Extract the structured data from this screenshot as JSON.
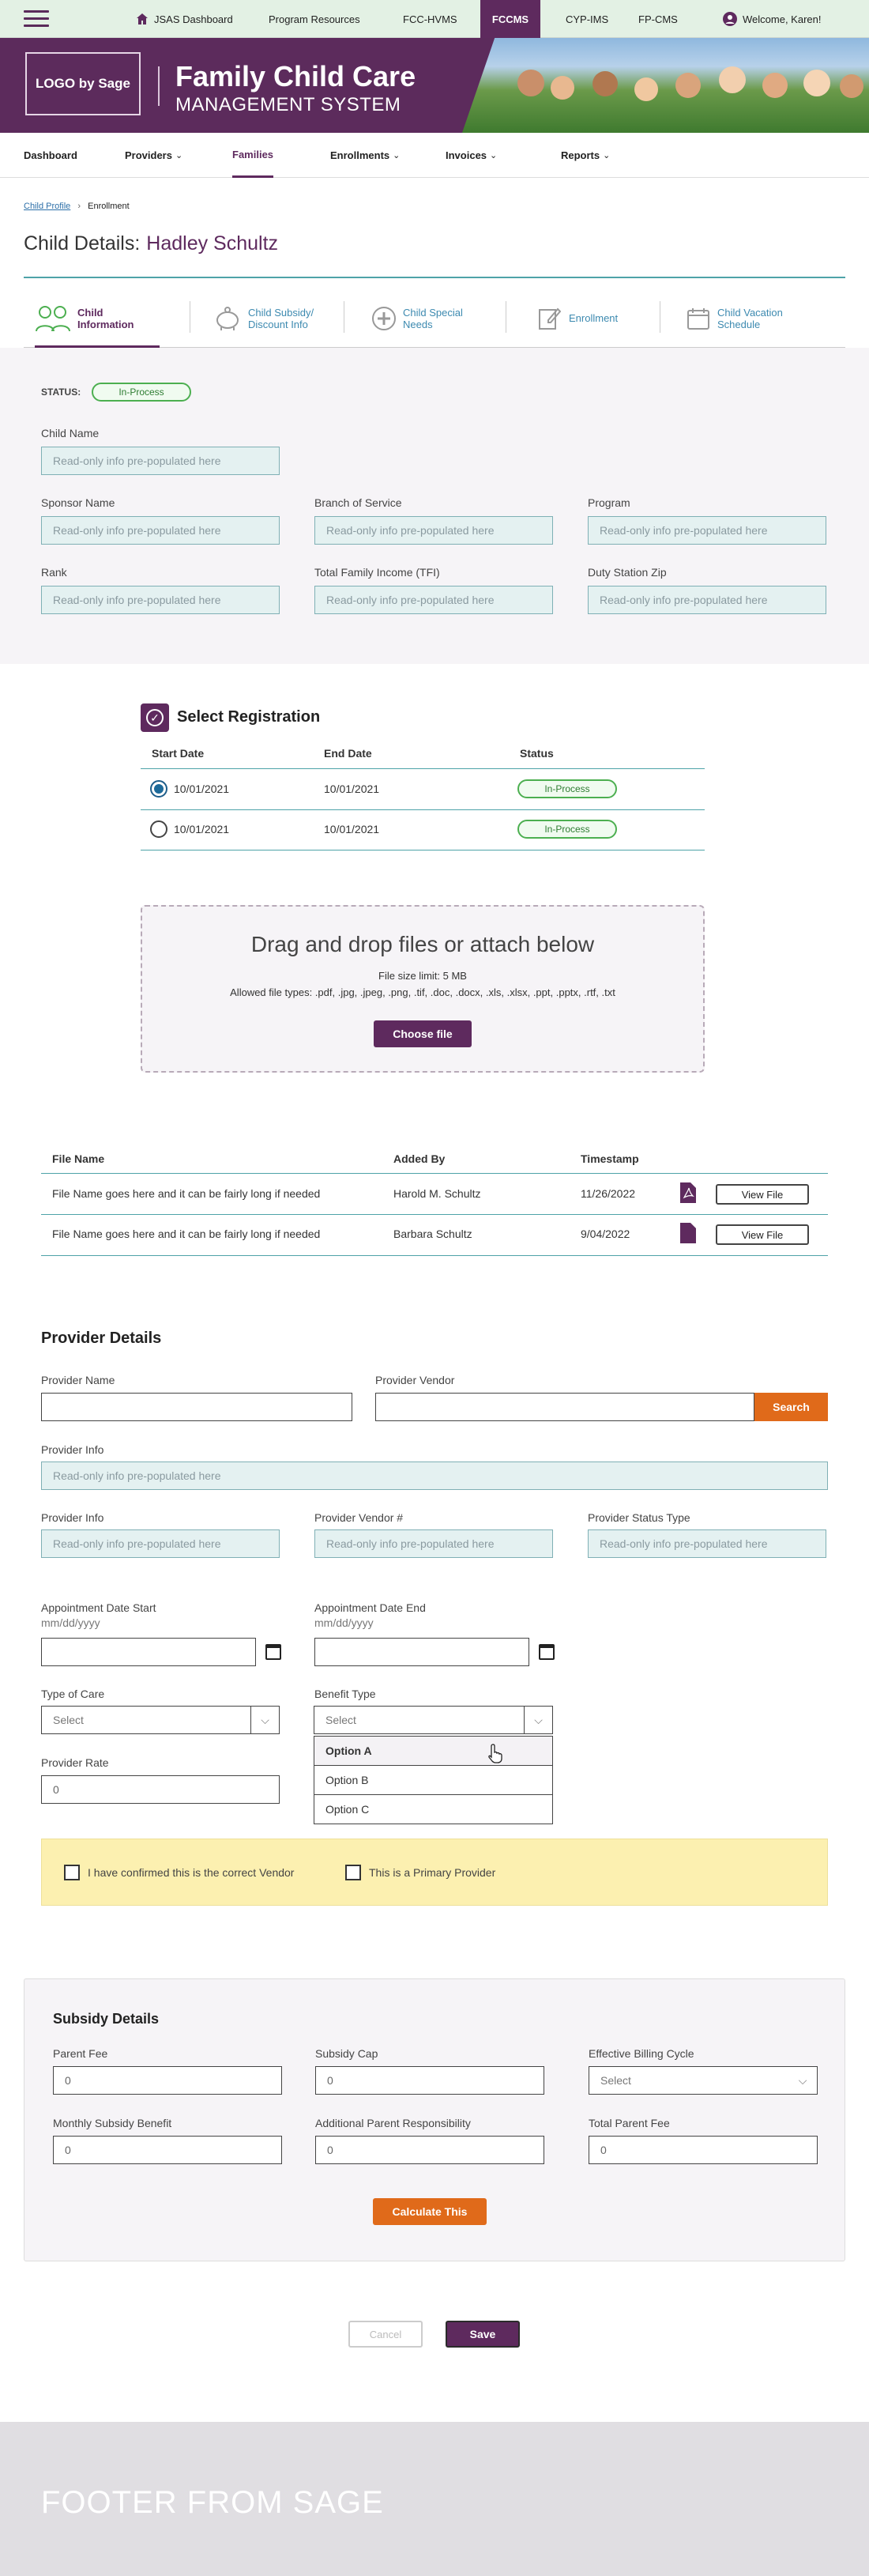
{
  "topnav": {
    "jsas": "JSAS Dashboard",
    "program": "Program Resources",
    "fcc": "FCC-HVMS",
    "fccms": "FCCMS",
    "cyp": "CYP-IMS",
    "fp": "FP-CMS",
    "welcome": "Welcome, Karen!"
  },
  "banner": {
    "logo": "LOGO by Sage",
    "title": "Family Child Care",
    "subtitle": "MANAGEMENT SYSTEM"
  },
  "mainnav": {
    "dashboard": "Dashboard",
    "providers": "Providers",
    "families": "Families",
    "enrollments": "Enrollments",
    "invoices": "Invoices",
    "reports": "Reports"
  },
  "breadcrumb": {
    "link": "Child Profile",
    "sep": "›",
    "current": "Enrollment"
  },
  "child": {
    "heading": "Child Details:",
    "name": "Hadley Schultz"
  },
  "tabs": {
    "t1a": "Child",
    "t1b": "Information",
    "t2a": "Child Subsidy/",
    "t2b": "Discount Info",
    "t3a": "Child Special",
    "t3b": "Needs",
    "t4": "Enrollment",
    "t5a": "Child Vacation",
    "t5b": "Schedule"
  },
  "status": {
    "label": "STATUS:",
    "value": "In-Process"
  },
  "fields": {
    "child_name": "Child Name",
    "sponsor": "Sponsor Name",
    "branch": "Branch of Service",
    "program": "Program",
    "rank": "Rank",
    "tfi": "Total Family Income (TFI)",
    "zip": "Duty Station Zip",
    "ro": "Read-only info pre-populated here"
  },
  "registration": {
    "title": "Select Registration",
    "h_start": "Start Date",
    "h_end": "End Date",
    "h_status": "Status",
    "rows": [
      {
        "start": "10/01/2021",
        "end": "10/01/2021",
        "status": "In-Process"
      },
      {
        "start": "10/01/2021",
        "end": "10/01/2021",
        "status": "In-Process"
      }
    ]
  },
  "upload": {
    "title": "Drag and drop files or attach below",
    "limit": "File size limit: 5 MB",
    "types": "Allowed file types: .pdf, .jpg, .jpeg, .png, .tif, .doc, .docx, .xls, .xlsx, .ppt, .pptx, .rtf, .txt",
    "button": "Choose file"
  },
  "files": {
    "h_name": "File Name",
    "h_by": "Added By",
    "h_time": "Timestamp",
    "view": "View File",
    "rows": [
      {
        "name": "File Name goes here and it can be fairly long if needed",
        "by": "Harold M. Schultz",
        "time": "11/26/2022"
      },
      {
        "name": "File Name goes here and it can be fairly long if needed",
        "by": "Barbara Schultz",
        "time": "9/04/2022"
      }
    ]
  },
  "provider": {
    "title": "Provider Details",
    "name": "Provider Name",
    "vendor": "Provider Vendor",
    "search": "Search",
    "info": "Provider Info",
    "vendor_num": "Provider Vendor #",
    "status_type": "Provider Status Type",
    "appt_start": "Appointment Date Start",
    "appt_end": "Appointment Date End",
    "date_hint": "mm/dd/yyyy",
    "type_care": "Type of Care",
    "benefit": "Benefit Type",
    "select": "Select",
    "rate": "Provider Rate",
    "rate_val": "0",
    "options": [
      "Option A",
      "Option B",
      "Option C"
    ],
    "confirm": "I have confirmed this is the correct Vendor",
    "primary": "This is a Primary Provider"
  },
  "subsidy": {
    "title": "Subsidy Details",
    "parent_fee": "Parent Fee",
    "cap": "Subsidy Cap",
    "cycle": "Effective Billing Cycle",
    "monthly": "Monthly Subsidy Benefit",
    "additional": "Additional Parent Responsibility",
    "total": "Total Parent Fee",
    "zero": "0",
    "select": "Select",
    "calc": "Calculate This"
  },
  "actions": {
    "cancel": "Cancel",
    "save": "Save"
  },
  "footer": {
    "text": "FOOTER FROM SAGE"
  },
  "colors": {
    "brand": "#5e2a5e",
    "accent": "#e06a1a",
    "teal": "#4ea3a8",
    "status_green": "#4caf50"
  }
}
